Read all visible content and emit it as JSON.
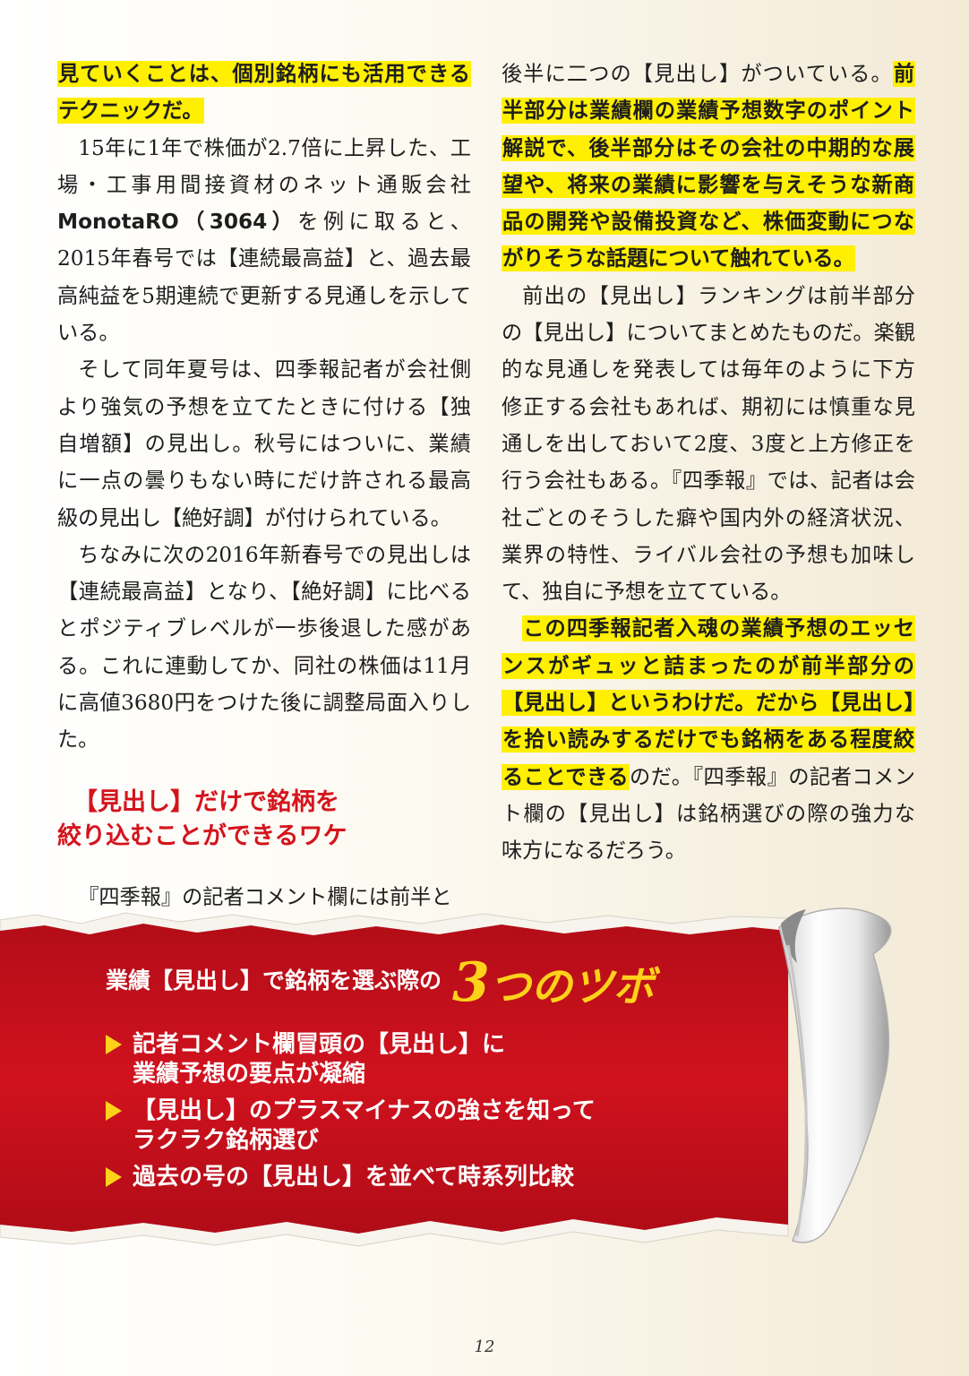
{
  "left_column": {
    "p1": {
      "highlight": "見ていくことは、個別銘柄にも活用できるテクニックだ。"
    },
    "p2": {
      "text_before": "15年に1年で株価が2.7倍に上昇した、工場・工事用間接資材のネット通販会社",
      "company": "MonotaRO（3064）",
      "text_after": "を例に取ると、2015年春号では【連続最高益】と、過去最高純益を5期連続で更新する見通しを示している。"
    },
    "p3": "そして同年夏号は、四季報記者が会社側より強気の予想を立てたときに付ける【独自増額】の見出し。秋号にはついに、業績に一点の曇りもない時にだけ許される最高級の見出し【絶好調】が付けられている。",
    "p4": "ちなみに次の2016年新春号での見出しは【連続最高益】となり、【絶好調】に比べるとポジティブレベルが一歩後退した感がある。これに連動してか、同社の株価は11月に高値3680円をつけた後に調整局面入りした。",
    "subhead": {
      "line1": "【見出し】だけで銘柄を",
      "line2": "絞り込むことができるワケ"
    },
    "p5": "『四季報』の記者コメント欄には前半と"
  },
  "right_column": {
    "p1": {
      "text_before": "後半に二つの【見出し】がついている。",
      "highlight": "前半部分は業績欄の業績予想数字のポイント解説で、後半部分はその会社の中期的な展望や、将来の業績に影響を与えそうな新商品の開発や設備投資など、株価変動につながりそうな話題について触れている。"
    },
    "p2": "前出の【見出し】ランキングは前半部分の【見出し】についてまとめたものだ。楽観的な見通しを発表しては毎年のように下方修正する会社もあれば、期初には慎重な見通しを出しておいて2度、3度と上方修正を行う会社もある。『四季報』では、記者は会社ごとのそうした癖や国内外の経済状況、業界の特性、ライバル会社の予想も加味して、独自に予想を立てている。",
    "p3": {
      "highlight": "この四季報記者入魂の業績予想のエッセンスがギュッと詰まったのが前半部分の【見出し】というわけだ。だから【見出し】を拾い読みするだけでも銘柄をある程度絞ることできる",
      "text_after": "のだ。『四季報』の記者コメント欄の【見出し】は銘柄選びの際の強力な味方になるだろう。"
    }
  },
  "banner": {
    "title_lead": "業績【見出し】で銘柄を選ぶ際の",
    "title_number": "3",
    "title_accent": "つのツボ",
    "points": [
      {
        "line1": "記者コメント欄冒頭の【見出し】に",
        "line2": "業績予想の要点が凝縮"
      },
      {
        "line1": "【見出し】のプラスマイナスの強さを知って",
        "line2": "ラクラク銘柄選び"
      },
      {
        "line1": "過去の号の【見出し】を並べて時系列比較",
        "line2": ""
      }
    ],
    "colors": {
      "red": "#c8101c",
      "accent": "#ffd21a",
      "paper": "#ffffff"
    }
  },
  "page_number": "12"
}
